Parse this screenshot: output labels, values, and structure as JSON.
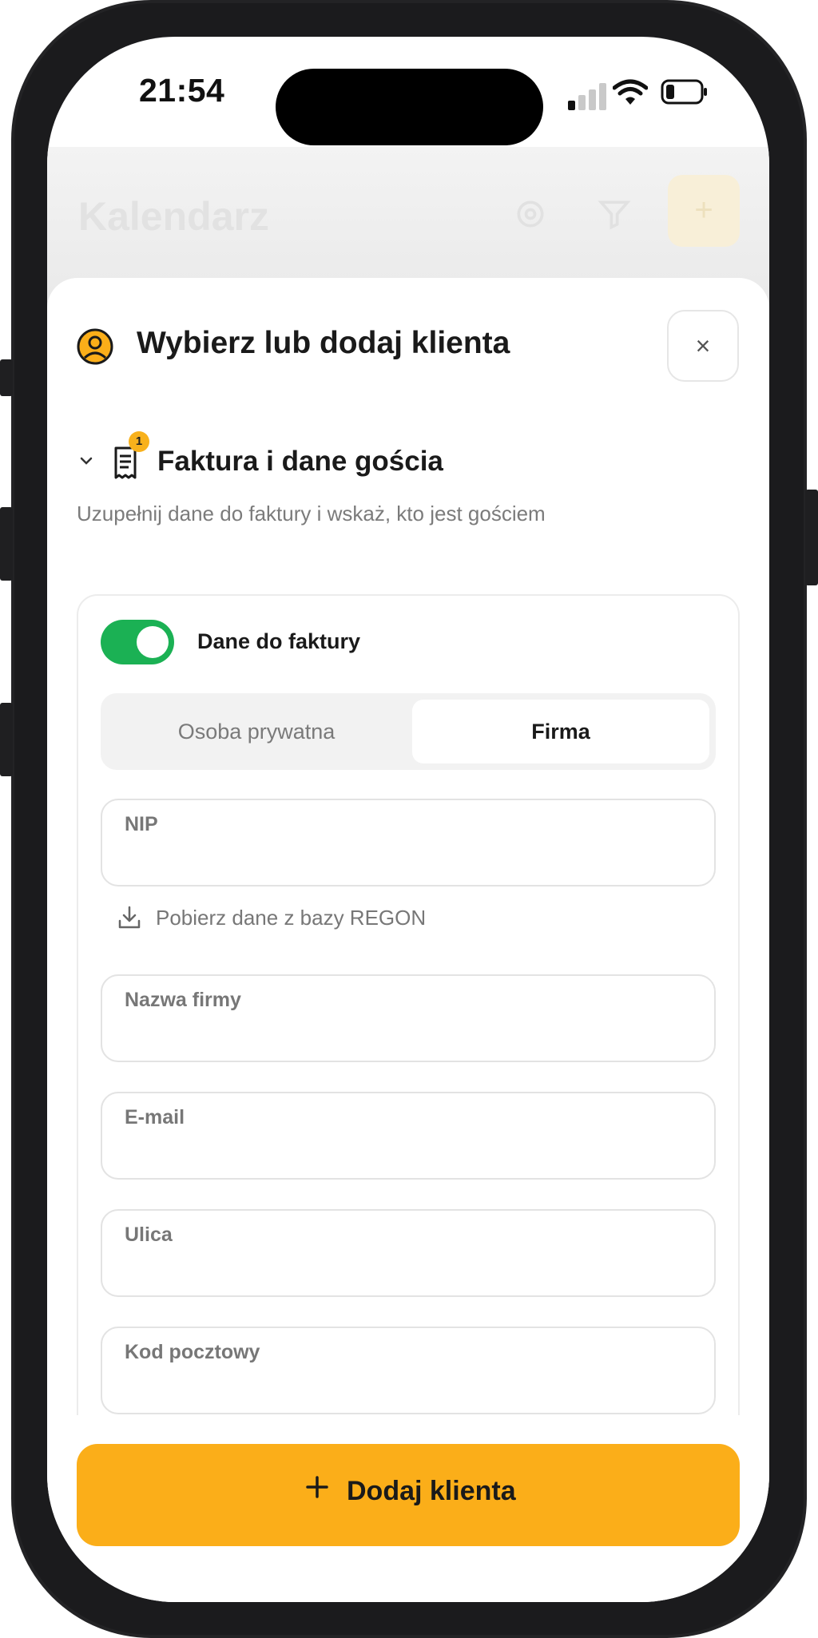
{
  "status": {
    "time": "21:54"
  },
  "background_header": {
    "title": "Kalendarz"
  },
  "modal": {
    "title": "Wybierz lub dodaj klienta",
    "close_label": "×",
    "section": {
      "badge": "1",
      "title": "Faktura i dane gościa",
      "subtitle": "Uzupełnij dane do faktury i wskaż, kto jest gościem"
    },
    "invoice_toggle": {
      "label": "Dane do faktury",
      "on": true
    },
    "segment": {
      "options": [
        "Osoba prywatna",
        "Firma"
      ],
      "selected": "Firma"
    },
    "fields": {
      "nip": "NIP",
      "regon_link": "Pobierz dane z bazy REGON",
      "company": "Nazwa firmy",
      "email": "E-mail",
      "street": "Ulica",
      "postal": "Kod pocztowy"
    },
    "add_button": "Dodaj klienta"
  },
  "colors": {
    "accent": "#fbae19",
    "toggle": "#1bb154",
    "badge": "#f8b11c"
  },
  "icons": [
    "user-circle-icon",
    "close-icon",
    "chevron-down-icon",
    "receipt-icon",
    "download-icon",
    "plus-icon",
    "gear-icon",
    "filter-icon",
    "signal-icon",
    "wifi-icon",
    "battery-icon"
  ]
}
